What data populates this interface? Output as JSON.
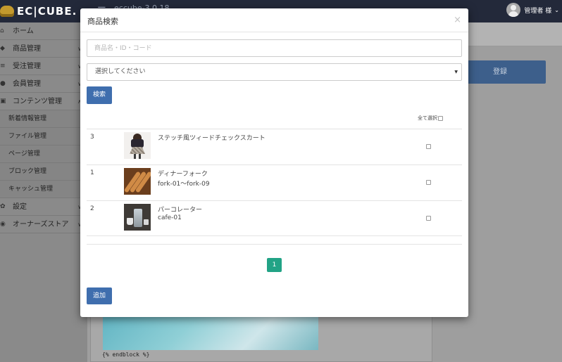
{
  "app": {
    "logo_text": "EC|CUBE.",
    "version_text": "eccube-3.0.18",
    "user_label": "管理者 様"
  },
  "sidebar": {
    "items": [
      {
        "label": "ホーム",
        "icon": "home-icon"
      },
      {
        "label": "商品管理",
        "icon": "tag-icon"
      },
      {
        "label": "受注管理",
        "icon": "cart-icon"
      },
      {
        "label": "会員管理",
        "icon": "user-icon"
      },
      {
        "label": "コンテンツ管理",
        "icon": "document-icon"
      },
      {
        "label": "新着情報管理"
      },
      {
        "label": "ファイル管理"
      },
      {
        "label": "ページ管理"
      },
      {
        "label": "ブロック管理"
      },
      {
        "label": "キャッシュ管理"
      },
      {
        "label": "設定",
        "icon": "gear-icon"
      },
      {
        "label": "オーナーズストア",
        "icon": "store-icon"
      }
    ]
  },
  "main": {
    "register_label": "登録",
    "code_snippet": "{% endblock %}"
  },
  "modal": {
    "title": "商品検索",
    "close_glyph": "×",
    "search_placeholder": "商品名・ID・コード",
    "search_value": "",
    "category_selected": "選択してください",
    "search_button": "検索",
    "select_all_label": "全て選択",
    "add_button": "追加",
    "current_page": "1",
    "results": [
      {
        "id": "3",
        "name": "ステッチ風ツィードチェックスカート",
        "code": "",
        "thumbnail": "skirt-photo"
      },
      {
        "id": "1",
        "name": "ディナーフォーク",
        "code": "fork-01～fork-09",
        "thumbnail": "fork-photo"
      },
      {
        "id": "2",
        "name": "パーコレーター",
        "code": "cafe-01",
        "thumbnail": "cafe-photo"
      }
    ]
  },
  "colors": {
    "topbar": "#23293a",
    "primary_button": "#3f6eae",
    "pager_active": "#22a386"
  }
}
